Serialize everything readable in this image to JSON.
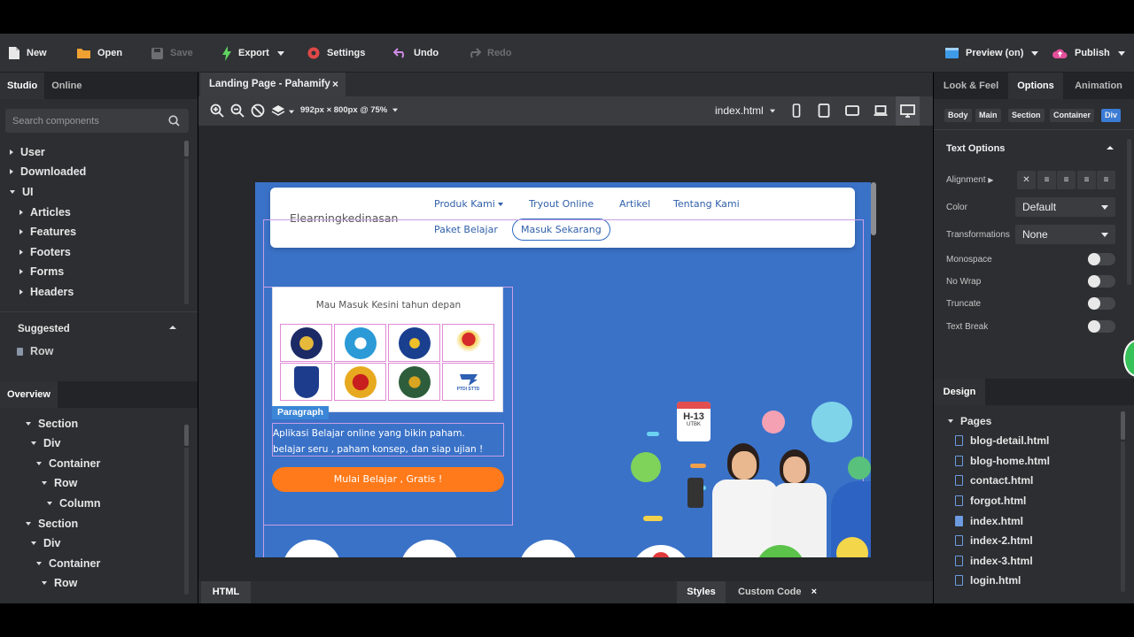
{
  "toolbar": {
    "new_label": "New",
    "open_label": "Open",
    "save_label": "Save",
    "export_label": "Export",
    "settings_label": "Settings",
    "undo_label": "Undo",
    "redo_label": "Redo",
    "preview_label": "Preview (on)",
    "publish_label": "Publish"
  },
  "left_panel": {
    "tabs": [
      "Studio",
      "Online"
    ],
    "search_placeholder": "Search components",
    "tree": [
      "User",
      "Downloaded",
      "UI",
      "Articles",
      "Features",
      "Footers",
      "Forms",
      "Headers"
    ],
    "suggested_title": "Suggested",
    "suggested_item": "Row",
    "overview_tab": "Overview",
    "overview_tree": [
      "Section",
      "Div",
      "Container",
      "Row",
      "Column",
      "Section",
      "Div",
      "Container",
      "Row"
    ]
  },
  "document": {
    "tab_title": "Landing Page - Pahamify",
    "tab_close": "×",
    "size_label": "992px × 800px @ 75%",
    "file_select": "index.html"
  },
  "preview": {
    "brand": "Elearningkedinasan",
    "nav": {
      "produk": "Produk Kami",
      "tryout": "Tryout Online",
      "artikel": "Artikel",
      "tentang": "Tentang Kami",
      "paket": "Paket Belajar",
      "masuk": "Masuk Sekarang"
    },
    "logos_heading": "Mau Masuk Kesini tahun depan",
    "paragraph_badge": "Paragraph",
    "paragraph_line1": "Aplikasi Belajar online yang bikin paham.",
    "paragraph_line2": "belajar seru , paham konsep, dan siap ujian !",
    "cta": "Mulai Belajar , Gratis !",
    "calendar_top": "H-13",
    "calendar_bottom": "UTBK",
    "logo_caption": "PTDI STTD"
  },
  "bottom_bar": {
    "html_tab": "HTML",
    "styles_tab": "Styles",
    "custom_code_tab": "Custom Code",
    "close": "×"
  },
  "right_panel": {
    "tabs": [
      "Look & Feel",
      "Options",
      "Animation"
    ],
    "chips": [
      "Body",
      "Main",
      "Section",
      "Container",
      "Div"
    ],
    "text_options_title": "Text Options",
    "alignment_label": "Alignment",
    "color_label": "Color",
    "color_value": "Default",
    "transformations_label": "Transformations",
    "transformations_value": "None",
    "toggles": [
      "Monospace",
      "No Wrap",
      "Truncate",
      "Text Break"
    ],
    "design_tab": "Design",
    "pages_title": "Pages",
    "pages": [
      "blog-detail.html",
      "blog-home.html",
      "contact.html",
      "forgot.html",
      "index.html",
      "index-2.html",
      "index-3.html",
      "login.html"
    ]
  },
  "colors": {
    "accent": "#3b7bd4",
    "page_bg": "#3a72c8",
    "cta": "#ff7a1a",
    "panel": "#2c2e31"
  }
}
